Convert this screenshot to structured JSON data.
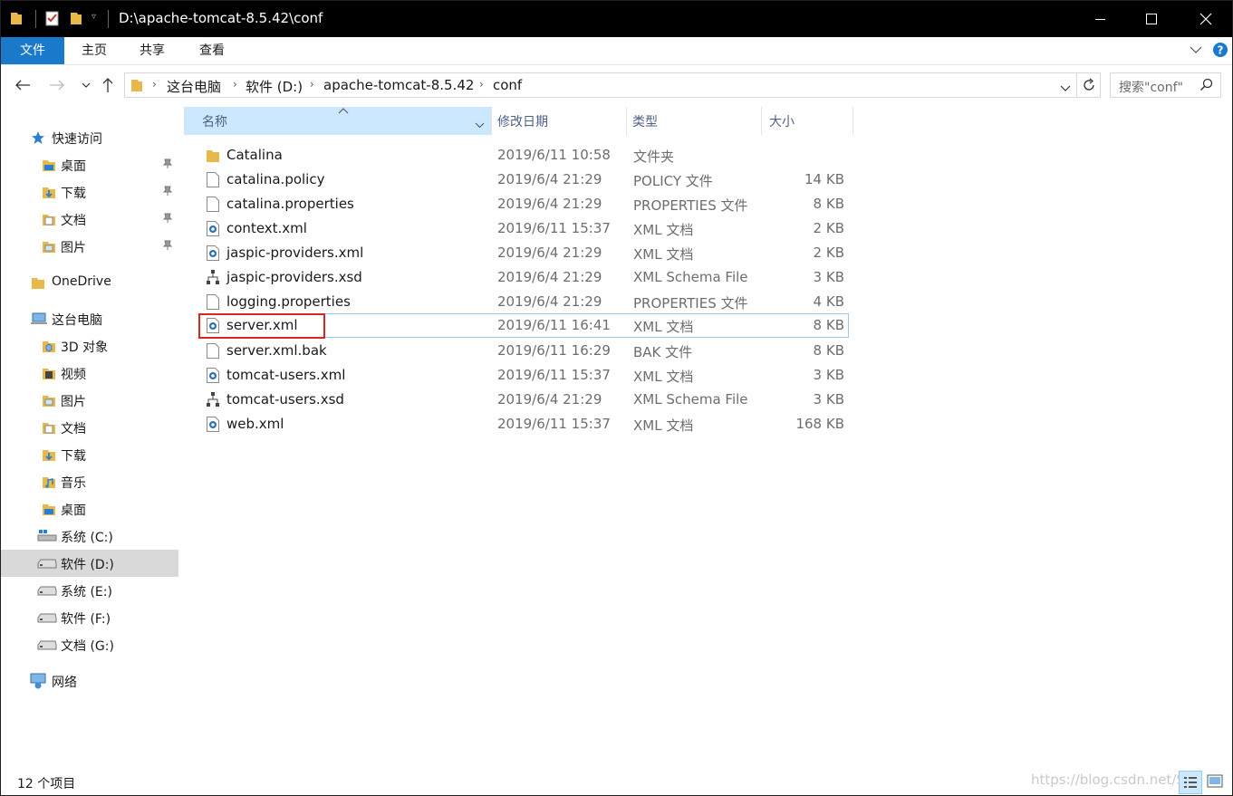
{
  "window": {
    "title": "D:\\apache-tomcat-8.5.42\\conf",
    "controls": [
      "minimize",
      "maximize",
      "close"
    ]
  },
  "ribbon": {
    "tabs": [
      "文件",
      "主页",
      "共享",
      "查看"
    ]
  },
  "address": {
    "breadcrumb": [
      "这台电脑",
      "软件 (D:)",
      "apache-tomcat-8.5.42",
      "conf"
    ],
    "search_placeholder": "搜索\"conf\""
  },
  "nav": {
    "items": [
      {
        "label": "快速访问",
        "icon": "star-icon",
        "pinned": false
      },
      {
        "label": "桌面",
        "icon": "desktop-folder-icon",
        "pinned": true
      },
      {
        "label": "下载",
        "icon": "downloads-folder-icon",
        "pinned": true
      },
      {
        "label": "文档",
        "icon": "documents-folder-icon",
        "pinned": true
      },
      {
        "label": "图片",
        "icon": "pictures-folder-icon",
        "pinned": true
      },
      {
        "label": "OneDrive",
        "icon": "onedrive-folder-icon",
        "pinned": false
      },
      {
        "label": "这台电脑",
        "icon": "computer-icon",
        "pinned": false
      },
      {
        "label": "3D 对象",
        "icon": "3d-objects-folder-icon",
        "pinned": false
      },
      {
        "label": "视频",
        "icon": "videos-folder-icon",
        "pinned": false
      },
      {
        "label": "图片",
        "icon": "pictures-folder-icon",
        "pinned": false
      },
      {
        "label": "文档",
        "icon": "documents-folder-icon",
        "pinned": false
      },
      {
        "label": "下载",
        "icon": "downloads-folder-icon",
        "pinned": false
      },
      {
        "label": "音乐",
        "icon": "music-folder-icon",
        "pinned": false
      },
      {
        "label": "桌面",
        "icon": "desktop-folder-icon",
        "pinned": false
      },
      {
        "label": "系统 (C:)",
        "icon": "windows-drive-icon",
        "pinned": false
      },
      {
        "label": "软件 (D:)",
        "icon": "drive-icon",
        "pinned": false,
        "selected": true
      },
      {
        "label": "系统 (E:)",
        "icon": "drive-icon",
        "pinned": false
      },
      {
        "label": "软件 (F:)",
        "icon": "drive-icon",
        "pinned": false
      },
      {
        "label": "文档 (G:)",
        "icon": "drive-icon",
        "pinned": false
      },
      {
        "label": "网络",
        "icon": "network-icon",
        "pinned": false
      }
    ]
  },
  "columns": {
    "name": "名称",
    "date": "修改日期",
    "type": "类型",
    "size": "大小"
  },
  "files": [
    {
      "name": "Catalina",
      "date": "2019/6/11 10:58",
      "type": "文件夹",
      "size": "",
      "icon": "folder-icon"
    },
    {
      "name": "catalina.policy",
      "date": "2019/6/4 21:29",
      "type": "POLICY 文件",
      "size": "14 KB",
      "icon": "file-icon"
    },
    {
      "name": "catalina.properties",
      "date": "2019/6/4 21:29",
      "type": "PROPERTIES 文件",
      "size": "8 KB",
      "icon": "file-icon"
    },
    {
      "name": "context.xml",
      "date": "2019/6/11 15:37",
      "type": "XML 文档",
      "size": "2 KB",
      "icon": "xml-file-icon"
    },
    {
      "name": "jaspic-providers.xml",
      "date": "2019/6/4 21:29",
      "type": "XML 文档",
      "size": "2 KB",
      "icon": "xml-file-icon"
    },
    {
      "name": "jaspic-providers.xsd",
      "date": "2019/6/4 21:29",
      "type": "XML Schema File",
      "size": "3 KB",
      "icon": "xsd-file-icon"
    },
    {
      "name": "logging.properties",
      "date": "2019/6/4 21:29",
      "type": "PROPERTIES 文件",
      "size": "4 KB",
      "icon": "file-icon"
    },
    {
      "name": "server.xml",
      "date": "2019/6/11 16:41",
      "type": "XML 文档",
      "size": "8 KB",
      "icon": "xml-file-icon",
      "highlighted": true
    },
    {
      "name": "server.xml.bak",
      "date": "2019/6/11 16:29",
      "type": "BAK 文件",
      "size": "8 KB",
      "icon": "file-icon"
    },
    {
      "name": "tomcat-users.xml",
      "date": "2019/6/11 15:37",
      "type": "XML 文档",
      "size": "3 KB",
      "icon": "xml-file-icon"
    },
    {
      "name": "tomcat-users.xsd",
      "date": "2019/6/4 21:29",
      "type": "XML Schema File",
      "size": "3 KB",
      "icon": "xsd-file-icon"
    },
    {
      "name": "web.xml",
      "date": "2019/6/11 15:37",
      "type": "XML 文档",
      "size": "168 KB",
      "icon": "xml-file-icon"
    }
  ],
  "status": {
    "item_count": "12 个项目"
  },
  "watermark": "https://blog.csdn.net/Si",
  "colors": {
    "file_tab": "#1979ca",
    "selected_column": "#cce8ff",
    "highlight_box": "#d9261f"
  }
}
